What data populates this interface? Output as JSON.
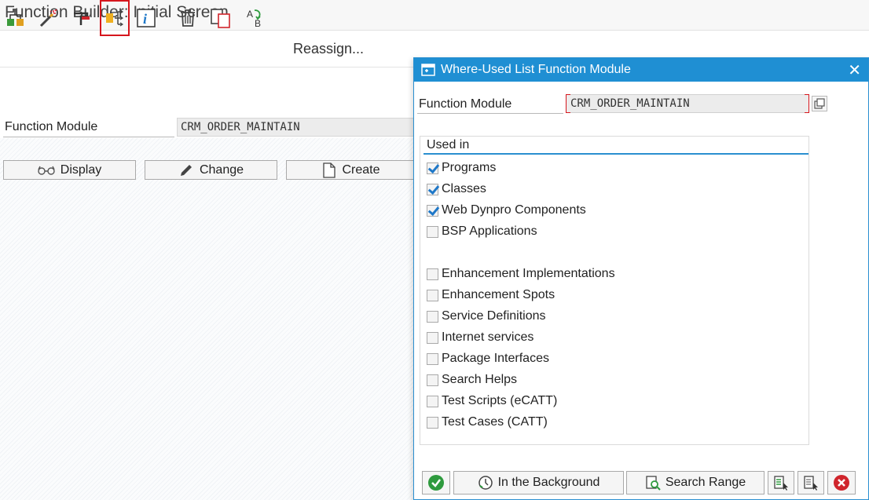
{
  "window": {
    "title": "Function Builder: Initial Screen"
  },
  "toolbar": {
    "icons": [
      "hierarchy-icon",
      "magic-wand-icon",
      "test-icon",
      "where-used-icon",
      "info-icon",
      "delete-icon",
      "copy-icon",
      "rename-icon"
    ],
    "reassign_label": "Reassign..."
  },
  "main": {
    "function_module_label": "Function Module",
    "function_module_value": "CRM_ORDER_MAINTAIN",
    "buttons": {
      "display": "Display",
      "change": "Change",
      "create": "Create"
    }
  },
  "dialog": {
    "title": "Where-Used List Function Module",
    "function_module_label": "Function Module",
    "function_module_value": "CRM_ORDER_MAINTAIN",
    "group_title": "Used in",
    "checkboxes": [
      {
        "label": "Programs",
        "checked": true
      },
      {
        "label": "Classes",
        "checked": true
      },
      {
        "label": "Web Dynpro Components",
        "checked": true
      },
      {
        "label": "BSP Applications",
        "checked": false
      },
      {
        "label": "Enhancement Implementations",
        "checked": false
      },
      {
        "label": "Enhancement Spots",
        "checked": false
      },
      {
        "label": "Service Definitions",
        "checked": false
      },
      {
        "label": "Internet services",
        "checked": false
      },
      {
        "label": "Package Interfaces",
        "checked": false
      },
      {
        "label": "Search Helps",
        "checked": false
      },
      {
        "label": "Test Scripts (eCATT)",
        "checked": false
      },
      {
        "label": "Test Cases (CATT)",
        "checked": false
      }
    ],
    "footer": {
      "background_label": "In the Background",
      "search_range_label": "Search Range"
    }
  },
  "colors": {
    "accent": "#1f8fd3",
    "highlight_border": "#d6161d",
    "confirm_green": "#2e9a3e",
    "cancel_red": "#d0252c"
  }
}
